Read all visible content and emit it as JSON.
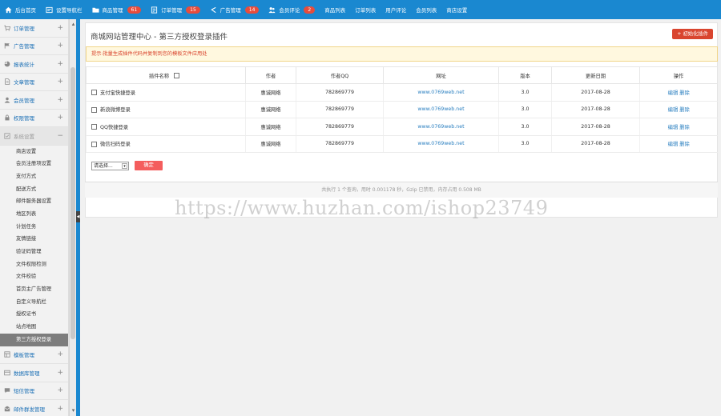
{
  "colors": {
    "accent": "#1a88d0",
    "danger": "#d9452f",
    "badge": "#e74c3c",
    "link": "#2a7fc0"
  },
  "topnav": [
    {
      "label": "后台首页",
      "icon": "home-icon"
    },
    {
      "label": "设置导航栏",
      "icon": "nav-settings-icon"
    },
    {
      "label": "商品管理",
      "icon": "folder-icon",
      "badge": "61"
    },
    {
      "label": "订单管理",
      "icon": "order-icon",
      "badge": "15"
    },
    {
      "label": "广告管理",
      "icon": "megaphone-icon",
      "badge": "14"
    },
    {
      "label": "会员评论",
      "icon": "users-icon",
      "badge": "2"
    },
    {
      "label": "商品列表",
      "icon": ""
    },
    {
      "label": "订单列表",
      "icon": ""
    },
    {
      "label": "用户评论",
      "icon": ""
    },
    {
      "label": "会员列表",
      "icon": ""
    },
    {
      "label": "商店设置",
      "icon": ""
    }
  ],
  "sidebar": {
    "groups_top": [
      {
        "label": "订单管理",
        "icon": "cart-icon"
      },
      {
        "label": "广告管理",
        "icon": "flag-icon"
      },
      {
        "label": "报表统计",
        "icon": "pie-chart-icon"
      },
      {
        "label": "文章管理",
        "icon": "doc-icon"
      },
      {
        "label": "会员管理",
        "icon": "user-icon"
      },
      {
        "label": "权限管理",
        "icon": "lock-icon"
      }
    ],
    "open_group": {
      "label": "系统设置",
      "icon": "settings-icon",
      "toggle": "−"
    },
    "sub_items": [
      "商店设置",
      "会员注册项设置",
      "支付方式",
      "配送方式",
      "邮件服务器设置",
      "地区列表",
      "计划任务",
      "友情链接",
      "验证码管理",
      "文件权限检测",
      "文件校验",
      "首页主广告管理",
      "自定义导航栏",
      "授权证书",
      "站点地图",
      "第三方授权登录"
    ],
    "active_sub": "第三方授权登录",
    "groups_bottom": [
      {
        "label": "模板管理",
        "icon": "template-icon"
      },
      {
        "label": "数据库管理",
        "icon": "database-icon"
      },
      {
        "label": "短信管理",
        "icon": "message-icon"
      },
      {
        "label": "邮件群发管理",
        "icon": "mail-icon"
      }
    ]
  },
  "main": {
    "title": "商城网站管理中心 - 第三方授权登录插件",
    "init_button": "+ 初始化插件",
    "notice": "提示:批量生成插件代码并复制到您的模板文件应用处",
    "columns": [
      "插件名称",
      "作者",
      "作者QQ",
      "网址",
      "版本",
      "更新日期",
      "操作"
    ],
    "rows": [
      {
        "name": "支付宝快捷登录",
        "author": "惠诚网络",
        "qq": "782869779",
        "url": "www.0769web.net",
        "version": "3.0",
        "date": "2017-08-28",
        "ops": [
          "编辑",
          "删除"
        ]
      },
      {
        "name": "新浪微博登录",
        "author": "惠诚网络",
        "qq": "782869779",
        "url": "www.0769web.net",
        "version": "3.0",
        "date": "2017-08-28",
        "ops": [
          "编辑",
          "删除"
        ]
      },
      {
        "name": "QQ快捷登录",
        "author": "惠诚网络",
        "qq": "782869779",
        "url": "www.0769web.net",
        "version": "3.0",
        "date": "2017-08-28",
        "ops": [
          "编辑",
          "删除"
        ]
      },
      {
        "name": "微信扫码登录",
        "author": "惠诚网络",
        "qq": "782869779",
        "url": "www.0769web.net",
        "version": "3.0",
        "date": "2017-08-28",
        "ops": [
          "编辑",
          "删除"
        ]
      }
    ],
    "bulk_select": "请选择...",
    "bulk_caret": "▾",
    "confirm_button": "确定",
    "footer": "共执行 1 个查询，用时 0.001178 秒，Gzip 已禁用，内存占用 0.508 MB"
  },
  "watermark": "https://www.huzhan.com/ishop23749"
}
